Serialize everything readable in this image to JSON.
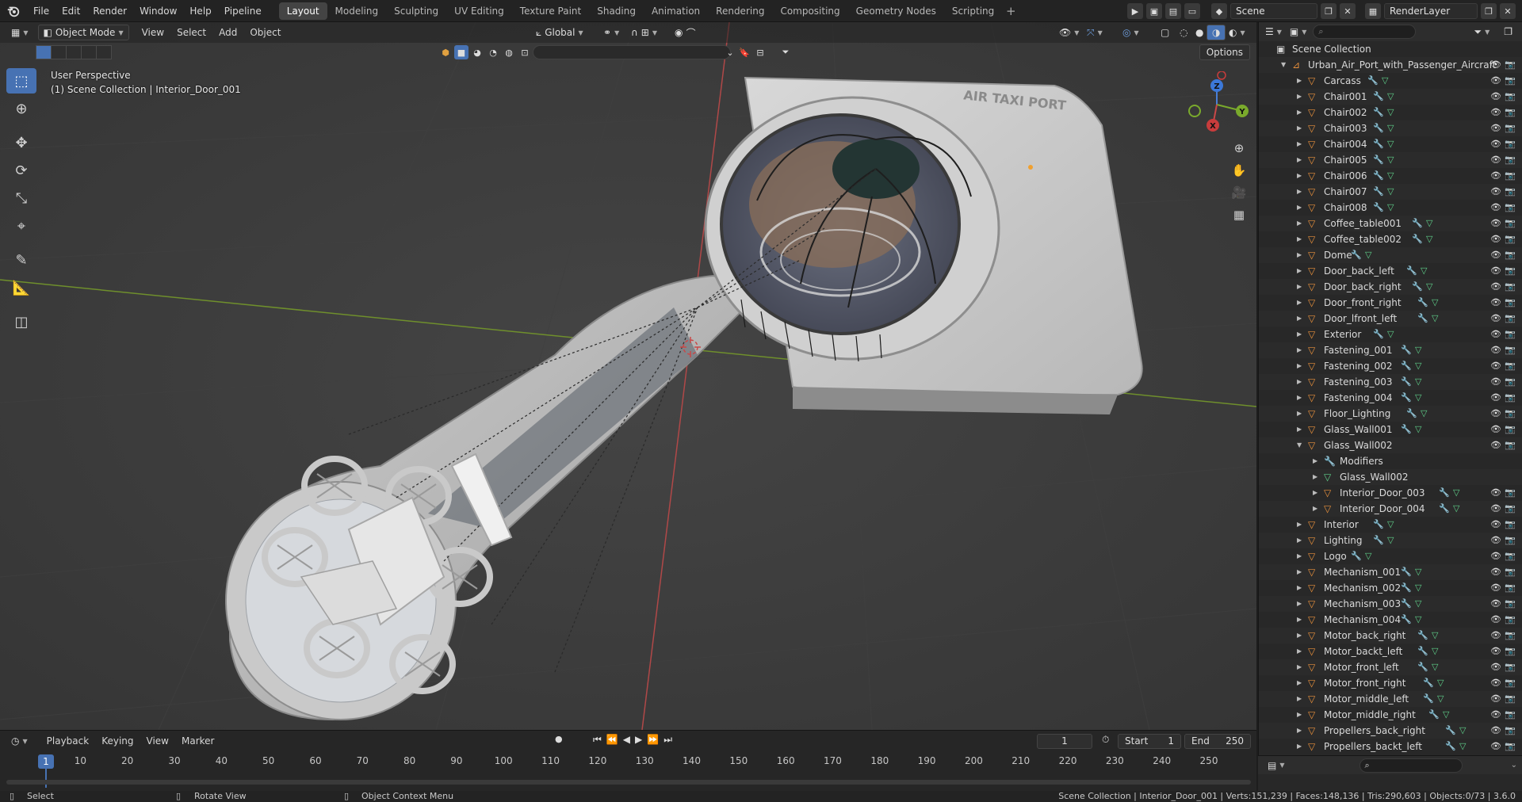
{
  "menu": [
    "File",
    "Edit",
    "Render",
    "Window",
    "Help",
    "Pipeline"
  ],
  "workspaces": [
    "Layout",
    "Modeling",
    "Sculpting",
    "UV Editing",
    "Texture Paint",
    "Shading",
    "Animation",
    "Rendering",
    "Compositing",
    "Geometry Nodes",
    "Scripting"
  ],
  "active_workspace": "Layout",
  "workspace_add": "+",
  "scene_name": "Scene",
  "view_layer": "RenderLayer",
  "viewport": {
    "mode": "Object Mode",
    "menus": [
      "View",
      "Select",
      "Add",
      "Object"
    ],
    "transform_orientation": "Global",
    "options_label": "Options",
    "overlay_title": "User Perspective",
    "overlay_subtitle": "(1) Scene Collection | Interior_Door_001",
    "sign_text": "AIR TAXI PORT",
    "gizmo_axes": {
      "z": "Z",
      "y": "Y",
      "x": "X"
    }
  },
  "timeline": {
    "menus": [
      "Playback",
      "Keying",
      "View",
      "Marker"
    ],
    "current_frame": "1",
    "start_label": "Start",
    "start_value": "1",
    "end_label": "End",
    "end_value": "250",
    "ticks": [
      "10",
      "20",
      "30",
      "40",
      "50",
      "60",
      "70",
      "80",
      "90",
      "100",
      "110",
      "120",
      "130",
      "140",
      "150",
      "160",
      "170",
      "180",
      "190",
      "200",
      "210",
      "220",
      "230",
      "240",
      "250"
    ],
    "cursor_label": "1"
  },
  "statusbar": {
    "select": "Select",
    "rotate": "Rotate View",
    "context": "Object Context Menu",
    "stats": "Scene Collection | Interior_Door_001 | Verts:151,239 | Faces:148,136 | Tris:290,603 | Objects:0/73 | 3.6.0"
  },
  "outliner": {
    "root": "Scene Collection",
    "collection": "Urban_Air_Port_with_Passenger_Aircraft",
    "items": [
      {
        "name": "Carcass"
      },
      {
        "name": "Chair001"
      },
      {
        "name": "Chair002"
      },
      {
        "name": "Chair003"
      },
      {
        "name": "Chair004"
      },
      {
        "name": "Chair005"
      },
      {
        "name": "Chair006"
      },
      {
        "name": "Chair007"
      },
      {
        "name": "Chair008"
      },
      {
        "name": "Coffee_table001"
      },
      {
        "name": "Coffee_table002"
      },
      {
        "name": "Dome"
      },
      {
        "name": "Door_back_left"
      },
      {
        "name": "Door_back_right"
      },
      {
        "name": "Door_front_right"
      },
      {
        "name": "Door_lfront_left"
      },
      {
        "name": "Exterior"
      },
      {
        "name": "Fastening_001"
      },
      {
        "name": "Fastening_002"
      },
      {
        "name": "Fastening_003"
      },
      {
        "name": "Fastening_004"
      },
      {
        "name": "Floor_Lighting"
      },
      {
        "name": "Glass_Wall001"
      },
      {
        "name": "Glass_Wall002"
      }
    ],
    "expanded_children": [
      {
        "name": "Modifiers",
        "kind": "modifiers"
      },
      {
        "name": "Glass_Wall002",
        "kind": "mesh"
      },
      {
        "name": "Interior_Door_003",
        "kind": "object"
      },
      {
        "name": "Interior_Door_004",
        "kind": "object"
      }
    ],
    "items_after": [
      {
        "name": "Interior"
      },
      {
        "name": "Lighting"
      },
      {
        "name": "Logo"
      },
      {
        "name": "Mechanism_001"
      },
      {
        "name": "Mechanism_002"
      },
      {
        "name": "Mechanism_003"
      },
      {
        "name": "Mechanism_004"
      },
      {
        "name": "Motor_back_right"
      },
      {
        "name": "Motor_backt_left"
      },
      {
        "name": "Motor_front_left"
      },
      {
        "name": "Motor_front_right"
      },
      {
        "name": "Motor_middle_left"
      },
      {
        "name": "Motor_middle_right"
      },
      {
        "name": "Propellers_back_right"
      },
      {
        "name": "Propellers_backt_left"
      }
    ]
  },
  "colors": {
    "accent": "#4772b3",
    "object_orange": "#e8903c",
    "modifier_blue": "#6f9fe0",
    "mesh_green": "#5fd08a",
    "axis_red": "#c84848",
    "axis_green": "#7aaa2c"
  }
}
